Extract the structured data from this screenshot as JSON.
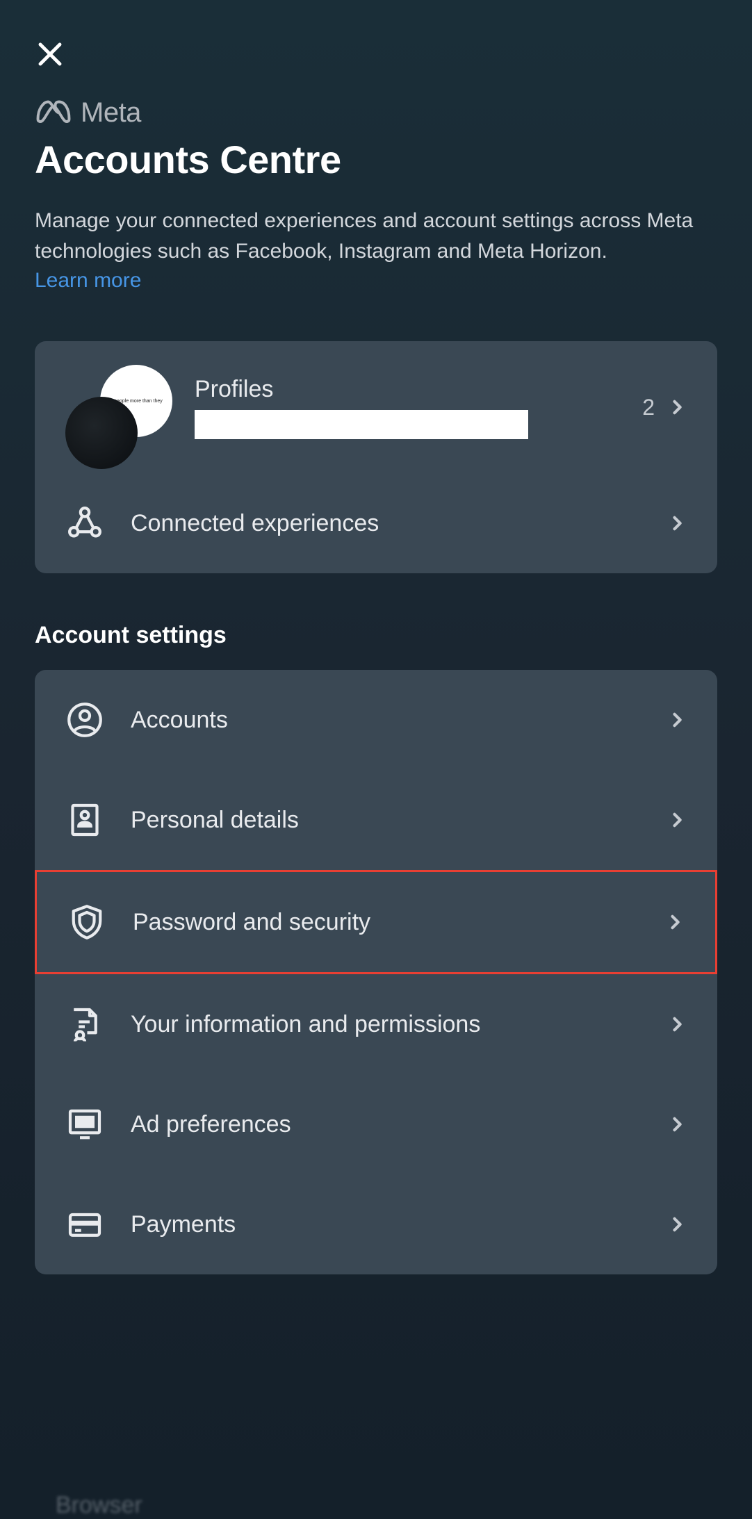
{
  "brand": {
    "name": "Meta"
  },
  "header": {
    "title": "Accounts Centre",
    "description": "Manage your connected experiences and account settings across Meta technologies such as Facebook, Instagram and Meta Horizon.",
    "learn_more": "Learn more"
  },
  "profiles": {
    "label": "Profiles",
    "count": "2"
  },
  "connected": {
    "label": "Connected experiences"
  },
  "section_title": "Account settings",
  "settings": {
    "accounts": "Accounts",
    "personal_details": "Personal details",
    "password_security": "Password and security",
    "info_permissions": "Your information and permissions",
    "ad_preferences": "Ad preferences",
    "payments": "Payments"
  },
  "bottom_peek": "Browser"
}
